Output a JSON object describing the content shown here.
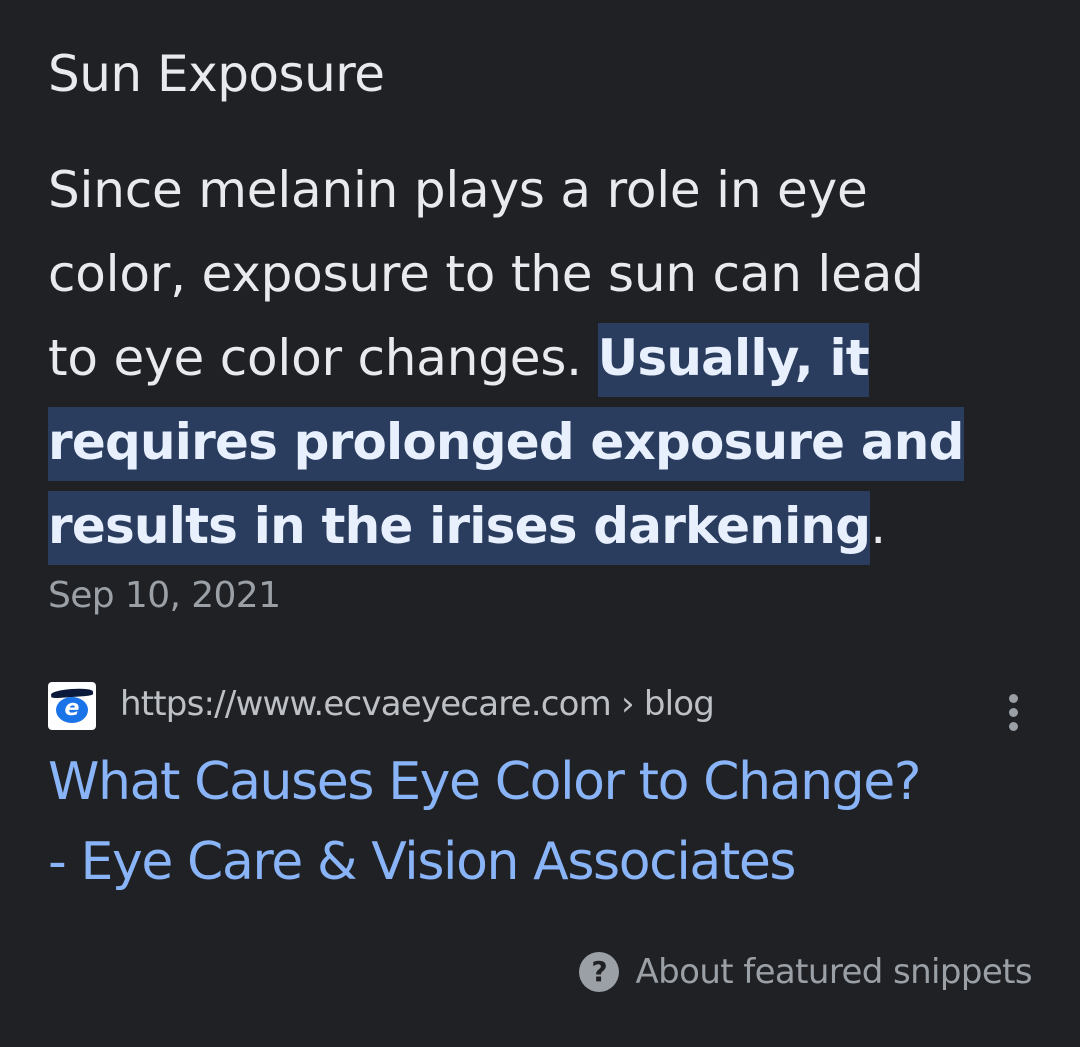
{
  "snippet": {
    "heading": "Sun Exposure",
    "text_plain": "Since melanin plays a role in eye color, exposure to the sun can lead to eye color changes.",
    "text_highlight": "Usually, it requires prolonged exposure and results in the irises darkening",
    "text_end": ".",
    "lines": {
      "l1": "Since melanin plays a role in eye",
      "l2": "color, exposure to the sun can lead",
      "l3_plain": "to eye color changes. ",
      "l3_highlight": "Usually, it",
      "l4_highlight": "requires prolonged exposure and",
      "l5_highlight": "results in the irises darkening",
      "l5_end": "."
    },
    "date": "Sep 10, 2021"
  },
  "result": {
    "favicon_icon": "ecva-eye-logo",
    "favicon_letter": "e",
    "url": "https://www.ecvaeyecare.com › blog",
    "more_icon": "more-vert-icon",
    "title": "What Causes Eye Color to Change? - Eye Care & Vision Associates",
    "title_lines": {
      "l1": "What Causes Eye Color to Change?",
      "l2": "- Eye Care & Vision Associates"
    }
  },
  "footer": {
    "about_icon": "help-circle-icon",
    "about_icon_glyph": "?",
    "about_label": "About featured snippets"
  },
  "colors": {
    "background": "#202124",
    "text": "#e8eaed",
    "highlight_bg": "#2b3d5e",
    "link": "#8ab4f8",
    "secondary": "#9aa0a6"
  }
}
